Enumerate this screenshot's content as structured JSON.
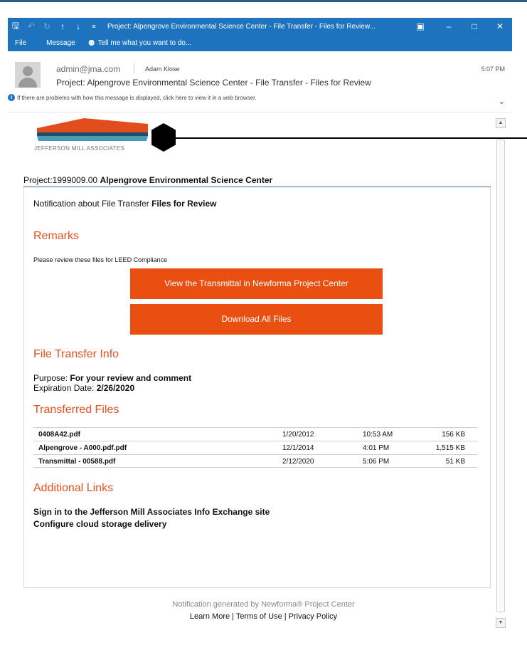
{
  "window": {
    "title": "Project: Alpengrove Environmental Science Center - File Transfer - Files for Review...",
    "menu": [
      "File",
      "Message"
    ],
    "tell_me": "Tell me what you want to do..."
  },
  "message": {
    "from": "admin@jma.com",
    "to": "Adam Klose",
    "time": "5:07 PM",
    "subject": "Project: Alpengrove Environmental Science Center - File Transfer - Files for Review",
    "info_bar": "If there are problems with how this message is displayed, click here to view it in a web browser."
  },
  "logo": {
    "caption": "JEFFERSON MILL ASSOCIATES"
  },
  "email": {
    "project_number": "Project:1999009.00",
    "project_name": "Alpengrove Environmental Science Center",
    "notification_prefix": "Notification about File Transfer",
    "notification_name": "Files for Review",
    "remarks_heading": "Remarks",
    "remarks_text": "Please review these files for LEED Compliance",
    "view_button": "View the Transmittal in Newforma Project Center",
    "download_button": "Download All Files",
    "info_heading": "File Transfer Info",
    "purpose_label": "Purpose:",
    "purpose_value": "For your review and comment",
    "expiration_label": "Expiration Date:",
    "expiration_value": "2/26/2020",
    "files_heading": "Transferred Files",
    "files": [
      {
        "name": "0408A42.pdf",
        "date": "1/20/2012",
        "time": "10:53 AM",
        "size": "156 KB"
      },
      {
        "name": "Alpengrove - A000.pdf.pdf",
        "date": "12/1/2014",
        "time": "4:01 PM",
        "size": "1,515 KB"
      },
      {
        "name": "Transmittal - 00588.pdf",
        "date": "2/12/2020",
        "time": "5:06 PM",
        "size": "51 KB"
      }
    ],
    "links_heading": "Additional Links",
    "link_signin": "Sign in to the Jefferson Mill Associates Info Exchange site",
    "link_cloud": "Configure cloud storage delivery"
  },
  "footer": {
    "generated": "Notification generated by Newforma® Project Center",
    "learn_more": "Learn More",
    "sep": "|",
    "terms": "Terms of Use",
    "privacy": "Privacy Policy"
  },
  "colors": {
    "titlebar": "#1e73be",
    "accent_orange": "#ea4f12",
    "heading_orange": "#e8501e",
    "project_rule": "#3b6fa0"
  }
}
